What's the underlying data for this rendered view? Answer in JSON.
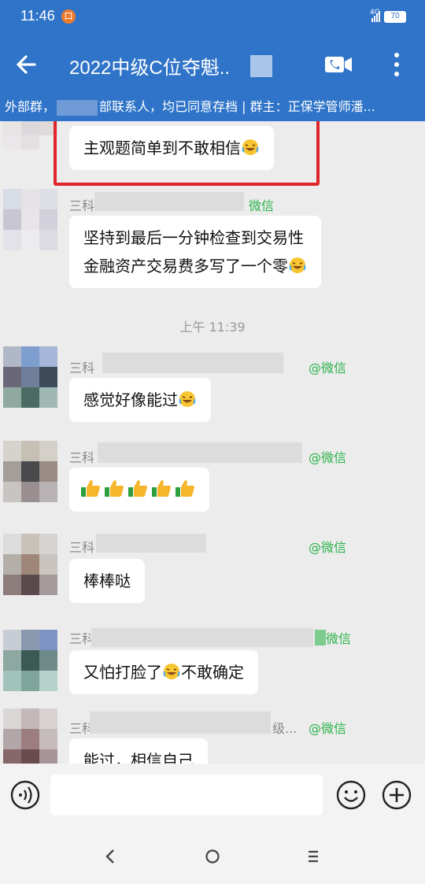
{
  "status": {
    "time": "11:46",
    "notification_badge": "口",
    "network": "4G",
    "battery": "70"
  },
  "header": {
    "title": "2022中级C位夺魁..",
    "back_icon": "arrow-left-icon",
    "video_icon": "video-call-icon",
    "more_icon": "more-vertical-icon"
  },
  "notice": {
    "part1": "外部群，",
    "part2": "部联系人，均已同意存档 | 群主：正保学管师潘..."
  },
  "messages": [
    {
      "bubble_lines": [
        "主观题简单到不敢相信"
      ],
      "emoji": "laughing-crying-face"
    },
    {
      "name": "三科",
      "source": "微信",
      "bubble_lines": [
        "坚持到最后一分钟检查到交易性",
        "金融资产交易费多写了一个零"
      ],
      "emoji": "laughing-crying-face"
    },
    {
      "timestamp": "上午 11:39"
    },
    {
      "name": "三科",
      "source": "@微信",
      "bubble_lines": [
        "感觉好像能过"
      ],
      "emoji": "laughing-crying-face"
    },
    {
      "name": "三科",
      "source": "@微信",
      "bubble_lines": [
        ""
      ],
      "thumbs_count": 5
    },
    {
      "name": "三科",
      "source": "@微信",
      "bubble_lines": [
        "棒棒哒"
      ]
    },
    {
      "name": "三科",
      "source": "微信",
      "bubble_lines": [
        "又怕打脸了",
        "不敢确定"
      ],
      "emoji": "laughing-crying-face"
    },
    {
      "name": "三科",
      "source_prefix": "级...",
      "source": "@微信",
      "bubble_lines": [
        "能过，相信自己"
      ]
    }
  ],
  "input": {
    "placeholder": "",
    "voice_icon": "voice-icon",
    "emoji_icon": "smiley-icon",
    "plus_icon": "plus-icon"
  },
  "navbar": {
    "back_icon": "nav-back-icon",
    "home_icon": "nav-home-icon",
    "menu_icon": "nav-menu-icon"
  },
  "colors": {
    "header": "#2f74c8",
    "highlight": "#e0262a",
    "source_green": "#2bb34b",
    "background": "#ececec"
  }
}
